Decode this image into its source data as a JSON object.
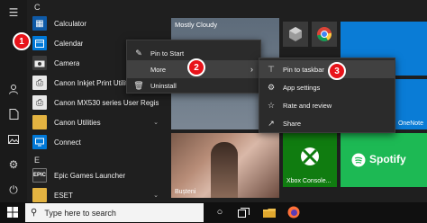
{
  "app_list": {
    "letters": [
      "C",
      "E"
    ],
    "items": [
      {
        "label": "Calculator",
        "icon": "calculator-icon"
      },
      {
        "label": "Calendar",
        "icon": "calendar-icon"
      },
      {
        "label": "Camera",
        "icon": "camera-icon"
      },
      {
        "label": "Canon Inkjet Print Utility",
        "icon": "printer-icon"
      },
      {
        "label": "Canon MX530 series User Regist...",
        "icon": "printer-icon"
      },
      {
        "label": "Canon Utilities",
        "icon": "folder-icon"
      },
      {
        "label": "Connect",
        "icon": "connect-icon"
      },
      {
        "label": "Epic Games Launcher",
        "icon": "epic-games-icon"
      },
      {
        "label": "ESET",
        "icon": "folder-icon"
      }
    ]
  },
  "tiles": {
    "weather": {
      "label": "Mostly Cloudy"
    },
    "photo": {
      "label": "Bușteni"
    },
    "onenote": {
      "label": "OneNote"
    },
    "xbox": {
      "label": "Xbox Console..."
    },
    "spotify": {
      "label": "Spotify"
    }
  },
  "context_menu": {
    "items": [
      {
        "label": "Pin to Start",
        "icon": "pin-icon"
      },
      {
        "label": "More",
        "icon": "",
        "submenu": true
      },
      {
        "label": "Uninstall",
        "icon": "trash-icon"
      }
    ]
  },
  "submenu": {
    "items": [
      {
        "label": "Pin to taskbar",
        "icon": "pin-taskbar-icon"
      },
      {
        "label": "App settings",
        "icon": "gear-icon"
      },
      {
        "label": "Rate and review",
        "icon": "star-icon"
      },
      {
        "label": "Share",
        "icon": "share-icon"
      }
    ]
  },
  "badges": [
    "1",
    "2",
    "3"
  ],
  "taskbar": {
    "search_placeholder": "Type here to search"
  },
  "colors": {
    "accent_blue": "#0078d7",
    "badge_red": "#e8131a",
    "spotify_green": "#1db954",
    "xbox_green": "#107c10",
    "onenote_purple": "#7719aa"
  }
}
